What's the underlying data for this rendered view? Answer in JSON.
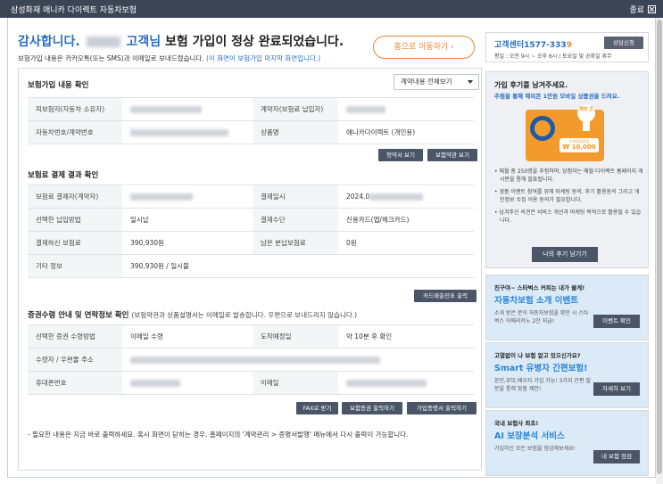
{
  "window": {
    "title": "삼성화재 애니카 다이렉트 자동차보험",
    "close_label": "종료"
  },
  "header": {
    "thanks_prefix": "감사합니다.",
    "thanks_customer": "고객님",
    "thanks_suffix": "보험 가입이 정상 완료되었습니다.",
    "notice_prefix": "보험가입 내용은 카카오톡(또는 SMS)과 이메일로 보내드렸습니다.",
    "notice_blue": "(이 화면이 보험가입 마지막 화면입니다.)",
    "home_button": "홈으로 이동하기 ›"
  },
  "section1": {
    "title": "보험가입 내용 확인",
    "dropdown_value": "계약내용 전체보기",
    "rows": [
      {
        "h1": "피보험자(자동차 소유자)",
        "h2": "계약자(보험료 납입자)",
        "v2": ""
      },
      {
        "h1": "자동차번호/계약번호",
        "h2": "상품명",
        "v2": "애니카다이렉트 (개인용)"
      }
    ],
    "btn_terms": "청약서 보기",
    "btn_policy": "보험약관 보기"
  },
  "section2": {
    "title": "보험료 결제 결과 확인",
    "rows": [
      {
        "h1": "보험료 결제자(계약자)",
        "v1": "",
        "h2": "결제일시",
        "v2": "2024.0"
      },
      {
        "h1": "선택한 납입방법",
        "v1": "일시납",
        "h2": "결제수단",
        "v2": "신용카드(앱/체크카드)"
      },
      {
        "h1": "결제하신 보험료",
        "v1": "390,930원",
        "h2": "남은 분납보험료",
        "v2": "0원"
      },
      {
        "h1": "기타 정보",
        "v1": "390,930원 / 일시불"
      }
    ],
    "btn_card": "카드매출전표 출력"
  },
  "section3": {
    "title": "증권수령 안내 및 연락정보 확인",
    "subtitle": "(보험약관과 상품설명서는 이메일로 발송합니다. 우편으로 보내드리지 않습니다.)",
    "rows": [
      {
        "h1": "선택한 증권 수령방법",
        "v1": "이메일 수령",
        "h2": "도착예정일",
        "v2": "약 10분 후 확인"
      },
      {
        "h1": "수령자 / 우편물 주소"
      },
      {
        "h1": "휴대폰번호",
        "h2": "이메일"
      }
    ],
    "btn_fax": "FAX로 받기",
    "btn_print": "보험증권 출력하기",
    "btn_cert": "가입증명서 출력하기"
  },
  "footer_note": "- 필요한 내용은 지금 바로 출력하세요. 혹시 화면이 닫히는 경우, 홈페이지의 '계약관리 > 증명서발행' 메뉴에서 다시 출력이 가능합니다.",
  "sidebar": {
    "call": {
      "label": "고객센터",
      "number": "1577-333",
      "number_last": "9",
      "hours": "평일 : 오전 9시 ~ 오후 6시 / 토요일 및 공휴일 휴무",
      "consult_button": "상담신청"
    },
    "review": {
      "title": "가입 후기를 남겨주세요.",
      "subtitle": "추첨을 통해 해피콘 1만원 모바일 상품권을 드려요.",
      "gift_badge": "해피 콘",
      "gift_price_label": "모바일상품권",
      "gift_price": "₩ 10,000",
      "bullets": [
        "• 매월 총 250명을 추첨하며, 당첨자는 매월 다이렉트 홈페이지 게시판을 통해 발표됩니다.",
        "• 경품 이벤트 참여를 위해 마케팅 동의, 후기 활용동의 그리고 개인정보 수집 이용 동의가 필요합니다.",
        "• 남겨주신 의견은 서비스 개선과 마케팅 목적으로 활용될 수 있습니다."
      ],
      "button": "나의 후기 남기기"
    },
    "promos": [
      {
        "line1": "친구야~ 스타벅스 커피는 내가 쏠게!",
        "line2": "자동차보험 소개 이벤트",
        "desc": "소개 받은 분이 자동차보험을 확인 시 스타벅스 아메리카노 2잔 지급!",
        "button": "이벤트 확인"
      },
      {
        "line1": "고열없이 나 보험 알고 있으신가요?",
        "line2": "Smart 유병자 간편보험!",
        "desc": "본인,부모,배우자 가입 가능! 3가지 간편 질문을 통해 맞춤 제안!",
        "button": "자세히 보기"
      },
      {
        "line1": "국내 보험사 최초!",
        "line2": "AI 보장분석 서비스",
        "desc": "가입하신 모든 보험을 점검해보세요!",
        "button": "내 보험 점검"
      }
    ]
  },
  "colors": {
    "accent_blue": "#2a6dc4",
    "accent_orange": "#e8893d",
    "button_dark": "#4a5567",
    "titlebar": "#3b4555"
  }
}
